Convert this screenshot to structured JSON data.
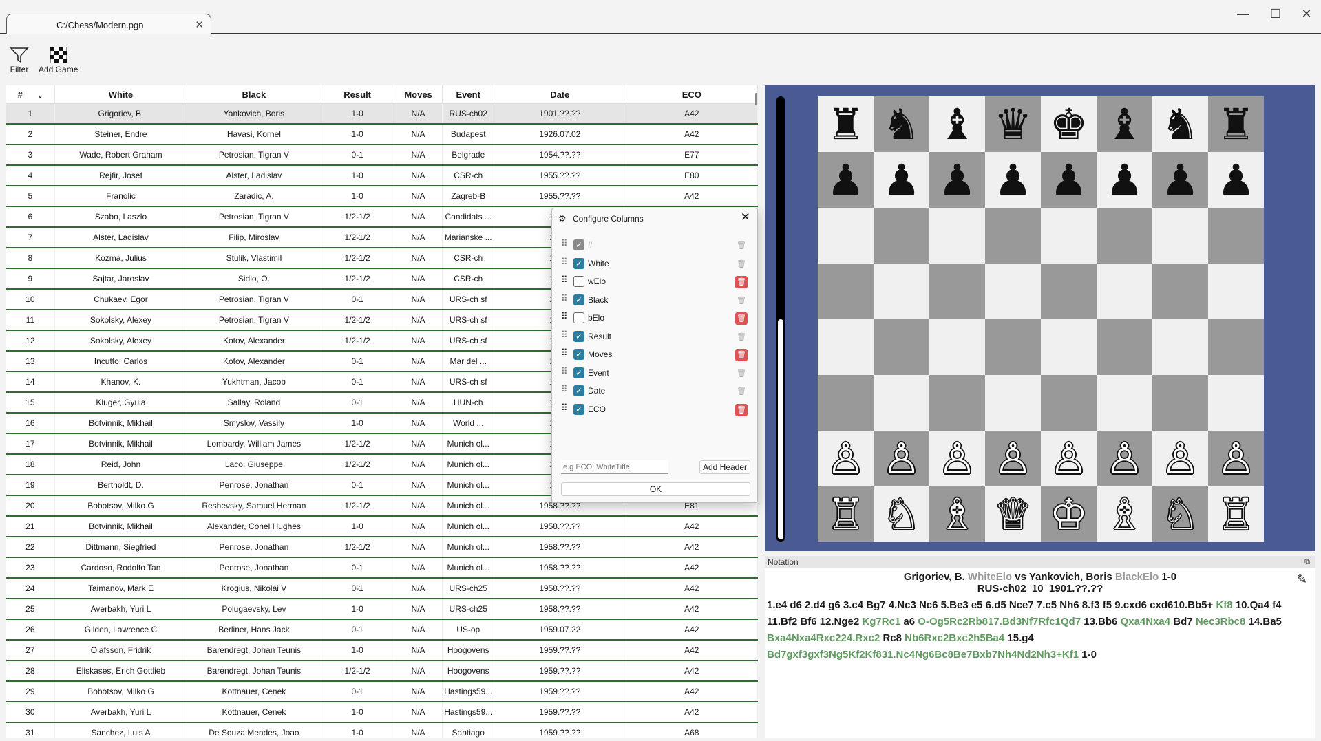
{
  "window": {
    "tab_title": "C:/Chess/Modern.pgn",
    "minimize": "—",
    "maximize": "☐",
    "close": "✕"
  },
  "toolbar": {
    "filter_label": "Filter",
    "add_game_label": "Add Game"
  },
  "table": {
    "headers": [
      "#",
      "White",
      "Black",
      "Result",
      "Moves",
      "Event",
      "Date",
      "ECO"
    ],
    "rows": [
      [
        "1",
        "Grigoriev, B.",
        "Yankovich, Boris",
        "1-0",
        "N/A",
        "RUS-ch02",
        "1901.??.??",
        "A42"
      ],
      [
        "2",
        "Steiner, Endre",
        "Havasi, Kornel",
        "1-0",
        "N/A",
        "Budapest",
        "1926.07.02",
        "A42"
      ],
      [
        "3",
        "Wade, Robert Graham",
        "Petrosian, Tigran V",
        "0-1",
        "N/A",
        "Belgrade",
        "1954.??.??",
        "E77"
      ],
      [
        "4",
        "Rejfir, Josef",
        "Alster, Ladislav",
        "1-0",
        "N/A",
        "CSR-ch",
        "1955.??.??",
        "E80"
      ],
      [
        "5",
        "Franolic",
        "Zaradic, A.",
        "1-0",
        "N/A",
        "Zagreb-B",
        "1955.??.??",
        "A42"
      ],
      [
        "6",
        "Szabo, Laszlo",
        "Petrosian, Tigran V",
        "1/2-1/2",
        "N/A",
        "Candidats ...",
        "1956.",
        ""
      ],
      [
        "7",
        "Alster, Ladislav",
        "Filip, Miroslav",
        "1/2-1/2",
        "N/A",
        "Marianske ...",
        "1956.",
        ""
      ],
      [
        "8",
        "Kozma, Julius",
        "Stulik, Vlastimil",
        "1/2-1/2",
        "N/A",
        "CSR-ch",
        "1956.",
        ""
      ],
      [
        "9",
        "Sajtar, Jaroslav",
        "Sidlo, O.",
        "1/2-1/2",
        "N/A",
        "CSR-ch",
        "1956.",
        ""
      ],
      [
        "10",
        "Chukaev, Egor",
        "Petrosian, Tigran V",
        "0-1",
        "N/A",
        "URS-ch sf",
        "1956.",
        ""
      ],
      [
        "11",
        "Sokolsky, Alexey",
        "Petrosian, Tigran V",
        "1/2-1/2",
        "N/A",
        "URS-ch sf",
        "1957.",
        ""
      ],
      [
        "12",
        "Sokolsky, Alexey",
        "Kotov, Alexander",
        "1/2-1/2",
        "N/A",
        "URS-ch sf",
        "1957.",
        ""
      ],
      [
        "13",
        "Incutto, Carlos",
        "Kotov, Alexander",
        "0-1",
        "N/A",
        "Mar del ...",
        "1957.",
        ""
      ],
      [
        "14",
        "Khanov, K.",
        "Yukhtman, Jacob",
        "0-1",
        "N/A",
        "URS-ch sf",
        "1957.",
        ""
      ],
      [
        "15",
        "Kluger, Gyula",
        "Sallay, Roland",
        "0-1",
        "N/A",
        "HUN-ch",
        "1958.",
        ""
      ],
      [
        "16",
        "Botvinnik, Mikhail",
        "Smyslov, Vassily",
        "1-0",
        "N/A",
        "World ...",
        "1958.",
        ""
      ],
      [
        "17",
        "Botvinnik, Mikhail",
        "Lombardy, William James",
        "1/2-1/2",
        "N/A",
        "Munich ol...",
        "1958.",
        ""
      ],
      [
        "18",
        "Reid, John",
        "Laco, Giuseppe",
        "1/2-1/2",
        "N/A",
        "Munich ol...",
        "1958.",
        ""
      ],
      [
        "19",
        "Bertholdt, D.",
        "Penrose, Jonathan",
        "0-1",
        "N/A",
        "Munich ol...",
        "1958.",
        ""
      ],
      [
        "20",
        "Bobotsov, Milko G",
        "Reshevsky, Samuel Herman",
        "1/2-1/2",
        "N/A",
        "Munich ol...",
        "1958.??.??",
        "E81"
      ],
      [
        "21",
        "Botvinnik, Mikhail",
        "Alexander, Conel Hughes",
        "1-0",
        "N/A",
        "Munich ol...",
        "1958.??.??",
        "A42"
      ],
      [
        "22",
        "Dittmann, Siegfried",
        "Penrose, Jonathan",
        "1/2-1/2",
        "N/A",
        "Munich ol...",
        "1958.??.??",
        "A42"
      ],
      [
        "23",
        "Cardoso, Rodolfo Tan",
        "Penrose, Jonathan",
        "0-1",
        "N/A",
        "Munich ol...",
        "1958.??.??",
        "A42"
      ],
      [
        "24",
        "Taimanov, Mark E",
        "Krogius, Nikolai V",
        "0-1",
        "N/A",
        "URS-ch25",
        "1958.??.??",
        "A42"
      ],
      [
        "25",
        "Averbakh, Yuri L",
        "Polugaevsky, Lev",
        "1-0",
        "N/A",
        "URS-ch25",
        "1958.??.??",
        "A42"
      ],
      [
        "26",
        "Gilden, Lawrence C",
        "Berliner, Hans Jack",
        "0-1",
        "N/A",
        "US-op",
        "1959.07.22",
        "A42"
      ],
      [
        "27",
        "Olafsson, Fridrik",
        "Barendregt, Johan Teunis",
        "1-0",
        "N/A",
        "Hoogovens",
        "1959.??.??",
        "A42"
      ],
      [
        "28",
        "Eliskases, Erich Gottlieb",
        "Barendregt, Johan Teunis",
        "1/2-1/2",
        "N/A",
        "Hoogovens",
        "1959.??.??",
        "A42"
      ],
      [
        "29",
        "Bobotsov, Milko G",
        "Kottnauer, Cenek",
        "0-1",
        "N/A",
        "Hastings59...",
        "1959.??.??",
        "A42"
      ],
      [
        "30",
        "Averbakh, Yuri L",
        "Kottnauer, Cenek",
        "1-0",
        "N/A",
        "Hastings59...",
        "1959.??.??",
        "A42"
      ],
      [
        "31",
        "Sanchez, Luis A",
        "De Souza Mendes, Joao",
        "1-0",
        "N/A",
        "Santiago",
        "1959.??.??",
        "A68"
      ]
    ]
  },
  "board": {
    "rows": [
      [
        "♜",
        "♞",
        "♝",
        "♛",
        "♚",
        "♝",
        "♞",
        "♜"
      ],
      [
        "♟",
        "♟",
        "♟",
        "♟",
        "♟",
        "♟",
        "♟",
        "♟"
      ],
      [
        "",
        "",
        "",
        "",
        "",
        "",
        "",
        ""
      ],
      [
        "",
        "",
        "",
        "",
        "",
        "",
        "",
        ""
      ],
      [
        "",
        "",
        "",
        "",
        "",
        "",
        "",
        ""
      ],
      [
        "",
        "",
        "",
        "",
        "",
        "",
        "",
        ""
      ],
      [
        "♙",
        "♙",
        "♙",
        "♙",
        "♙",
        "♙",
        "♙",
        "♙"
      ],
      [
        "♖",
        "♘",
        "♗",
        "♕",
        "♔",
        "♗",
        "♘",
        "♖"
      ]
    ],
    "light_color": "#f0f0f0",
    "dark_color": "#999999",
    "panel_color": "#4a5a92"
  },
  "notation": {
    "title": "Notation",
    "restore_icon": "⧉",
    "white": "Grigoriev, B.",
    "white_elo": "WhiteElo",
    "vs": "vs",
    "black": "Yankovich, Boris",
    "black_elo": "BlackElo",
    "result": "1-0",
    "event_line": "RUS-ch02  10  1901.??.??",
    "edit_icon": "✎",
    "moves": [
      {
        "t": "1.e4 d6 2.d4 g6 3.c4 Bg7 4.Nc3 Nc6 5.Be3 e5 6.d5 Nce7 7.c5 Nh6 8.f3 f5 9.cxd6 cxd610.Bb5+ ",
        "v": false
      },
      {
        "t": "Kf8",
        "v": true
      },
      {
        "t": " 10.Qa4 f4 11.Bf2 Bf6 12.Nge2 ",
        "v": false
      },
      {
        "t": "Kg7Rc1",
        "v": true
      },
      {
        "t": " a6 ",
        "v": false
      },
      {
        "t": "O-Og5Rc2Rb817.Bd3Nf7Rfc1Qd7",
        "v": true
      },
      {
        "t": " 13.Bb6 ",
        "v": false
      },
      {
        "t": "Qxa4Nxa4",
        "v": true
      },
      {
        "t": " Bd7 ",
        "v": false
      },
      {
        "t": "Nec3Rbc8",
        "v": true
      },
      {
        "t": " 14.Ba5 ",
        "v": false
      },
      {
        "t": "Bxa4Nxa4Rxc224.Rxc2",
        "v": true
      },
      {
        "t": " Rc8 ",
        "v": false
      },
      {
        "t": "Nb6Rxc2Bxc2h5Ba4",
        "v": true
      },
      {
        "t": " 15.g4 ",
        "v": false
      },
      {
        "t": "Bd7gxf3gxf3Ng5Kf2Kf831.Nc4Ng6Bc8Be7Bxb7Nh4Nd2Nh3+Kf1",
        "v": true
      },
      {
        "t": " 1-0",
        "v": false
      }
    ]
  },
  "dialog": {
    "title": "Configure Columns",
    "icon": "⚙",
    "close": "✕",
    "columns": [
      {
        "label": "#",
        "checked": true,
        "disabled": true,
        "red": false,
        "strong": false
      },
      {
        "label": "White",
        "checked": true,
        "disabled": false,
        "red": false,
        "strong": false
      },
      {
        "label": "wElo",
        "checked": false,
        "disabled": false,
        "red": true,
        "strong": true
      },
      {
        "label": "Black",
        "checked": true,
        "disabled": false,
        "red": false,
        "strong": false
      },
      {
        "label": "bElo",
        "checked": false,
        "disabled": false,
        "red": true,
        "strong": true
      },
      {
        "label": "Result",
        "checked": true,
        "disabled": false,
        "red": false,
        "strong": false
      },
      {
        "label": "Moves",
        "checked": true,
        "disabled": false,
        "red": true,
        "strong": true
      },
      {
        "label": "Event",
        "checked": true,
        "disabled": false,
        "red": false,
        "strong": false
      },
      {
        "label": "Date",
        "checked": true,
        "disabled": false,
        "red": false,
        "strong": false
      },
      {
        "label": "ECO",
        "checked": true,
        "disabled": false,
        "red": true,
        "strong": true
      }
    ],
    "header_placeholder": "e.g ECO, WhiteTitle",
    "add_header_label": "Add Header",
    "ok_label": "OK"
  }
}
